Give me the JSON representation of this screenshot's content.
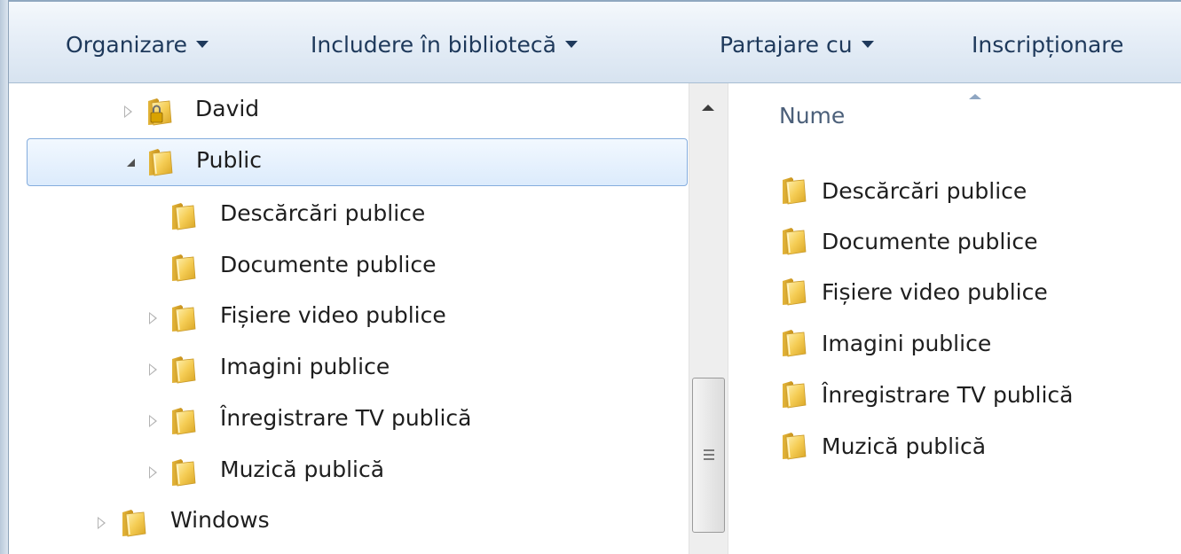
{
  "toolbar": {
    "organize": "Organizare",
    "include": "Includere în bibliotecă",
    "share": "Partajare cu",
    "burn": "Inscripționare"
  },
  "nav_tree": [
    {
      "label": "David",
      "state": "collapsed",
      "icon": "locked-folder-icon"
    },
    {
      "label": "Public",
      "state": "expanded",
      "selected": true,
      "icon": "folder-icon"
    },
    {
      "label": "Descărcări publice",
      "state": "leaf",
      "icon": "folder-icon"
    },
    {
      "label": "Documente publice",
      "state": "leaf",
      "icon": "folder-icon"
    },
    {
      "label": "Fișiere video publice",
      "state": "collapsed",
      "icon": "folder-icon"
    },
    {
      "label": "Imagini publice",
      "state": "collapsed",
      "icon": "folder-icon"
    },
    {
      "label": "Înregistrare TV publică",
      "state": "collapsed",
      "icon": "folder-icon"
    },
    {
      "label": "Muzică publică",
      "state": "collapsed",
      "icon": "folder-icon"
    },
    {
      "label": "Windows",
      "state": "collapsed",
      "icon": "folder-icon"
    }
  ],
  "content": {
    "column_name": "Nume",
    "items": [
      "Descărcări publice",
      "Documente publice",
      "Fișiere video publice",
      "Imagini publice",
      "Înregistrare TV publică",
      "Muzică publică"
    ]
  },
  "colors": {
    "toolbar_text": "#1e395b",
    "folder": "#f3c74a",
    "selection_border": "#84acdd"
  }
}
